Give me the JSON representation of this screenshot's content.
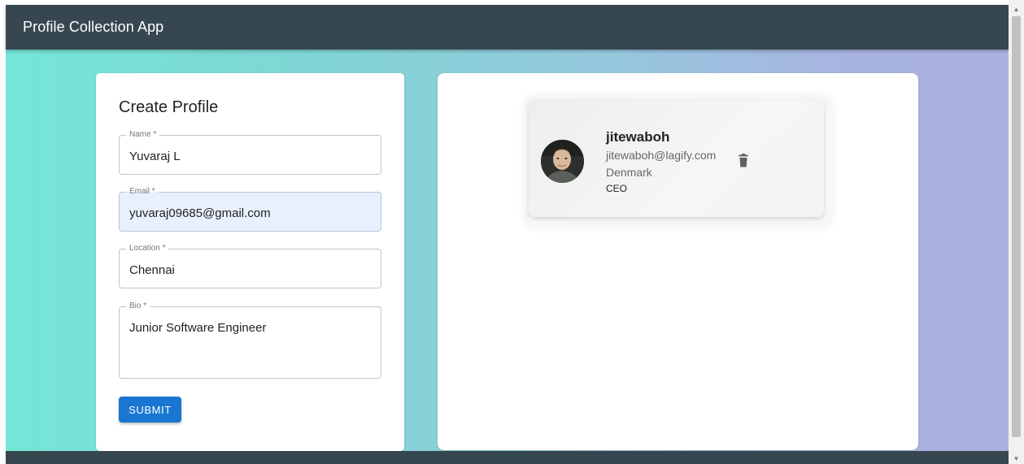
{
  "appbar": {
    "title": "Profile Collection App"
  },
  "form": {
    "title": "Create Profile",
    "fields": [
      {
        "label": "Name *",
        "value": "Yuvaraj L"
      },
      {
        "label": "Email *",
        "value": "yuvaraj09685@gmail.com"
      },
      {
        "label": "Location *",
        "value": "Chennai"
      },
      {
        "label": "Bio *",
        "value": "Junior Software Engineer"
      }
    ],
    "submit_label": "SUBMIT"
  },
  "profiles": [
    {
      "name": "jitewaboh",
      "email": "jitewaboh@lagify.com",
      "location": "Denmark",
      "bio": "CEO",
      "avatar_icon": "person-photo",
      "action_icon": "trash-icon"
    }
  ],
  "colors": {
    "appbar": "#37474f",
    "submit": "#1976d2",
    "gradient_start": "#74e6d6",
    "gradient_end": "#aab3e0"
  }
}
